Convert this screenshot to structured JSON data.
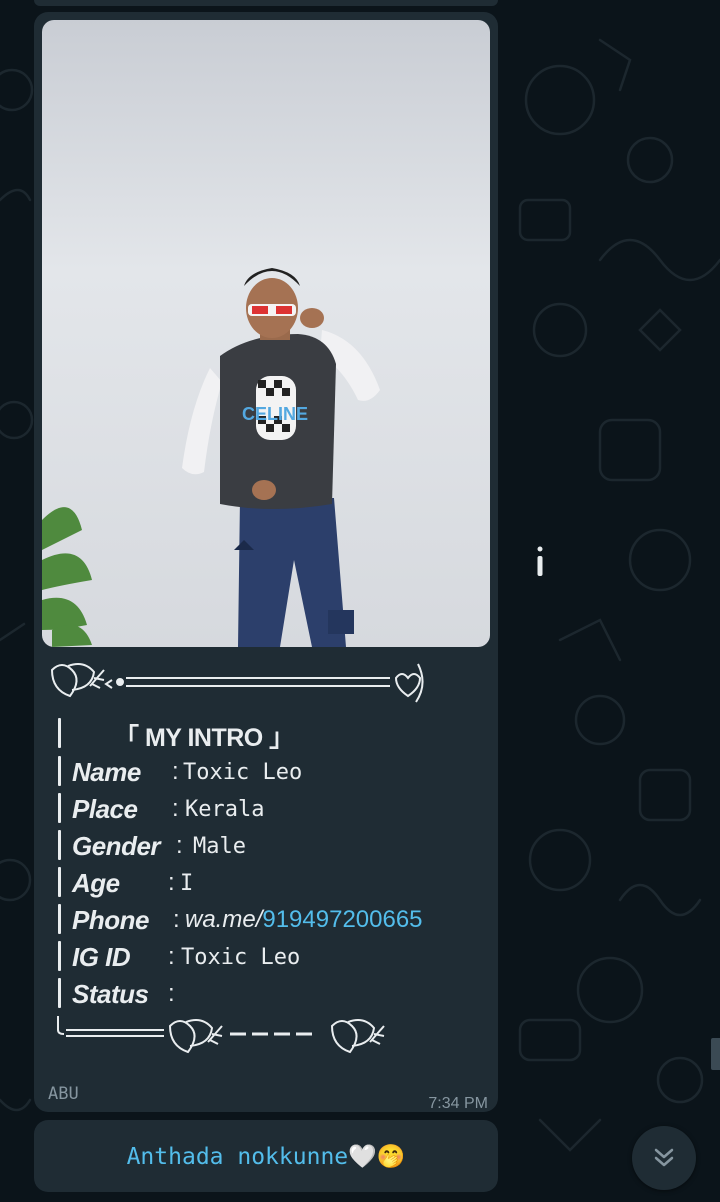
{
  "message": {
    "intro_title": "「 MY INTRO 」",
    "fields": [
      {
        "label": "Name",
        "value": "Toxic Leo"
      },
      {
        "label": "Place",
        "value": "Kerala"
      },
      {
        "label": "Gender",
        "value": "Male"
      },
      {
        "label": "Age",
        "value": "I"
      },
      {
        "label": "Phone",
        "value_prefix": "wa.me/",
        "value_link": "919497200665"
      },
      {
        "label": "IG ID",
        "value": "Toxic Leo"
      },
      {
        "label": "Status",
        "value": ""
      }
    ],
    "sender": "ABU",
    "time": "7:34 PM"
  },
  "photo": {
    "shirt_text": "CELINE"
  },
  "caption": {
    "text": "Anthada nokkunne🤍🤭"
  },
  "icons": [
    "info-icon",
    "chevron-down-icon"
  ],
  "colors": {
    "bubble": "#1f2c34",
    "background": "#0b141a",
    "link": "#53bdeb",
    "meta": "#8696a0"
  }
}
